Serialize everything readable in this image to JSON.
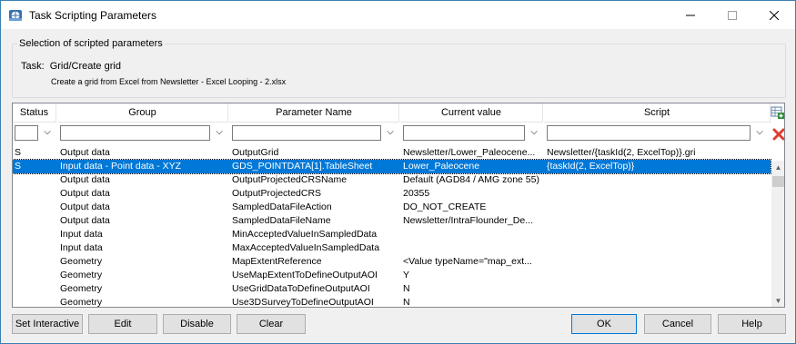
{
  "window": {
    "title": "Task Scripting Parameters"
  },
  "selection": {
    "legend": "Selection of scripted parameters",
    "task_label": "Task:",
    "task_value": "Grid/Create grid",
    "task_description": "Create a grid from Excel from Newsletter - Excel Looping - 2.xlsx"
  },
  "grid": {
    "columns": [
      "Status",
      "Group",
      "Parameter Name",
      "Current value",
      "Script"
    ],
    "rows": [
      {
        "status": "S",
        "group": "Output data",
        "param": "OutputGrid",
        "value": "Newsletter/Lower_Paleocene...",
        "script": "Newsletter/{taskId(2, ExcelTop)}.gri",
        "selected": false
      },
      {
        "status": "S",
        "group": "Input data - Point data - XYZ",
        "param": "GDS_POINTDATA[1].TableSheet",
        "value": "Lower_Paleocene",
        "script": "{taskId(2, ExcelTop)}",
        "selected": true
      },
      {
        "status": "",
        "group": "Output data",
        "param": "OutputProjectedCRSName",
        "value": "Default (AGD84 / AMG zone 55)",
        "script": "",
        "selected": false
      },
      {
        "status": "",
        "group": "Output data",
        "param": "OutputProjectedCRS",
        "value": "20355",
        "script": "",
        "selected": false
      },
      {
        "status": "",
        "group": "Output data",
        "param": "SampledDataFileAction",
        "value": "DO_NOT_CREATE",
        "script": "",
        "selected": false
      },
      {
        "status": "",
        "group": "Output data",
        "param": "SampledDataFileName",
        "value": "Newsletter/IntraFlounder_De...",
        "script": "",
        "selected": false
      },
      {
        "status": "",
        "group": "Input data",
        "param": "MinAcceptedValueInSampledData",
        "value": "",
        "script": "",
        "selected": false
      },
      {
        "status": "",
        "group": "Input data",
        "param": "MaxAcceptedValueInSampledData",
        "value": "",
        "script": "",
        "selected": false
      },
      {
        "status": "",
        "group": "Geometry",
        "param": "MapExtentReference",
        "value": "<Value typeName=\"map_ext...",
        "script": "",
        "selected": false
      },
      {
        "status": "",
        "group": "Geometry",
        "param": "UseMapExtentToDefineOutputAOI",
        "value": "Y",
        "script": "",
        "selected": false
      },
      {
        "status": "",
        "group": "Geometry",
        "param": "UseGridDataToDefineOutputAOI",
        "value": "N",
        "script": "",
        "selected": false
      },
      {
        "status": "",
        "group": "Geometry",
        "param": "Use3DSurveyToDefineOutputAOI",
        "value": "N",
        "script": "",
        "selected": false
      }
    ]
  },
  "buttons": {
    "set_interactive": "Set Interactive",
    "edit": "Edit",
    "disable": "Disable",
    "clear": "Clear",
    "ok": "OK",
    "cancel": "Cancel",
    "help": "Help"
  },
  "icons": {
    "app": "app-globe-icon",
    "add_row": "table-add-icon",
    "delete": "red-x-icon"
  },
  "colors": {
    "selection": "#0078d7",
    "delete_icon": "#e03c31",
    "add_icon": "#2e8b3a"
  }
}
